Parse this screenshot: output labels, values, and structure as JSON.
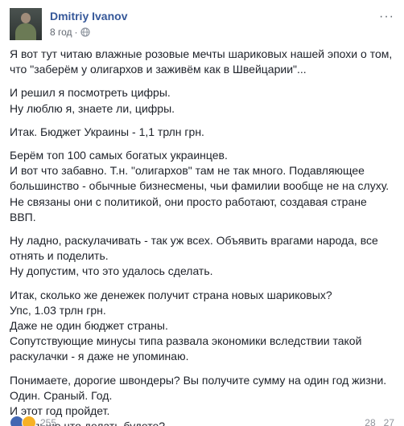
{
  "post": {
    "author": "Dmitriy Ivanov",
    "time": "8 год",
    "separator": "·",
    "privacy_icon": "globe-icon",
    "menu_label": "···",
    "paragraphs": [
      {
        "lines": [
          "Я вот тут читаю влажные розовые мечты шариковых нашей эпохи о том,",
          "что \"заберём у олигархов и заживём как в Швейцарии\"..."
        ]
      },
      {
        "lines": [
          "И решил я посмотреть цифры.",
          "Ну люблю я, знаете ли, цифры."
        ]
      },
      {
        "lines": [
          "Итак. Бюджет Украины - 1,1 трлн грн."
        ]
      },
      {
        "lines": [
          "Берём топ 100 самых богатых украинцев.",
          "И вот что забавно. Т.н. \"олигархов\" там не так много. Подавляющее",
          "большинство - обычные бизнесмены, чьи фамилии вообще не на слуху.",
          "Не связаны они с политикой, они просто работают, создавая стране",
          "ВВП."
        ]
      },
      {
        "lines": [
          "Ну ладно, раскулачивать - так уж всех. Объявить врагами народа, все",
          "отнять и поделить.",
          "Ну допустим, что это удалось сделать."
        ]
      },
      {
        "lines": [
          "Итак, сколько же денежек получит страна новых шариковых?",
          "Упс, 1.03 трлн грн.",
          "Даже не один бюджет страны.",
          "Сопутствующие минусы типа развала экономики вследствии такой",
          "раскулачки - я даже не упоминаю."
        ]
      },
      {
        "lines": [
          "Понимаете, дорогие швондеры? Вы получите сумму на один год жизни.",
          "Один. Сраный. Год.",
          "И этот год пройдет.",
          "А дальше что делать будете?"
        ]
      }
    ]
  },
  "footer": {
    "reaction_count": "255",
    "comments": "28",
    "shares": "27"
  },
  "colors": {
    "author": "#365899",
    "text": "#1d2129",
    "meta": "#616770"
  }
}
